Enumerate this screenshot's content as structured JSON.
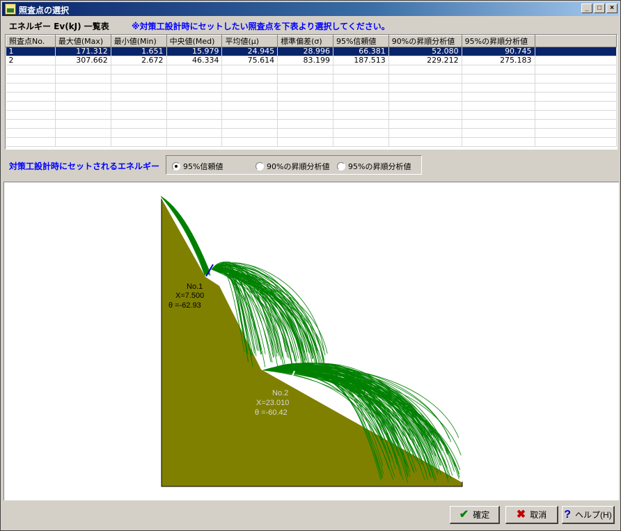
{
  "window": {
    "title": "照査点の選択"
  },
  "grid": {
    "section_label": "エネルギー Ev(kJ) 一覧表",
    "instruction": "※対策工設計時にセットしたい照査点を下表より選択してください。",
    "columns": [
      "照査点No.",
      "最大値(Max)",
      "最小値(Min)",
      "中央値(Med)",
      "平均値(μ)",
      "標準偏差(σ)",
      "95%信頼値",
      "90%の昇順分析値",
      "95%の昇順分析値"
    ],
    "rows": [
      [
        "1",
        "171.312",
        "1.651",
        "15.979",
        "24.945",
        "28.996",
        "66.381",
        "52.080",
        "90.745"
      ],
      [
        "2",
        "307.662",
        "2.672",
        "46.334",
        "75.614",
        "83.199",
        "187.513",
        "229.212",
        "275.183"
      ]
    ],
    "selected_row": 0
  },
  "energy": {
    "label": "対策工設計時にセットされるエネルギー",
    "options": [
      "95%信頼値",
      "90%の昇順分析値",
      "95%の昇順分析値"
    ],
    "selected": 0
  },
  "points": [
    {
      "no": "No.1",
      "x": "X=7.500",
      "theta": "θ =-62.93"
    },
    {
      "no": "No.2",
      "x": "X=23.010",
      "theta": "θ =-60.42"
    }
  ],
  "buttons": {
    "ok": "確定",
    "cancel": "取消",
    "help": "ヘルプ(H)"
  },
  "colors": {
    "slope": "#808000",
    "trajectory": "#008000",
    "title_bar": "#0a246a",
    "accent_text": "#0000ff"
  }
}
